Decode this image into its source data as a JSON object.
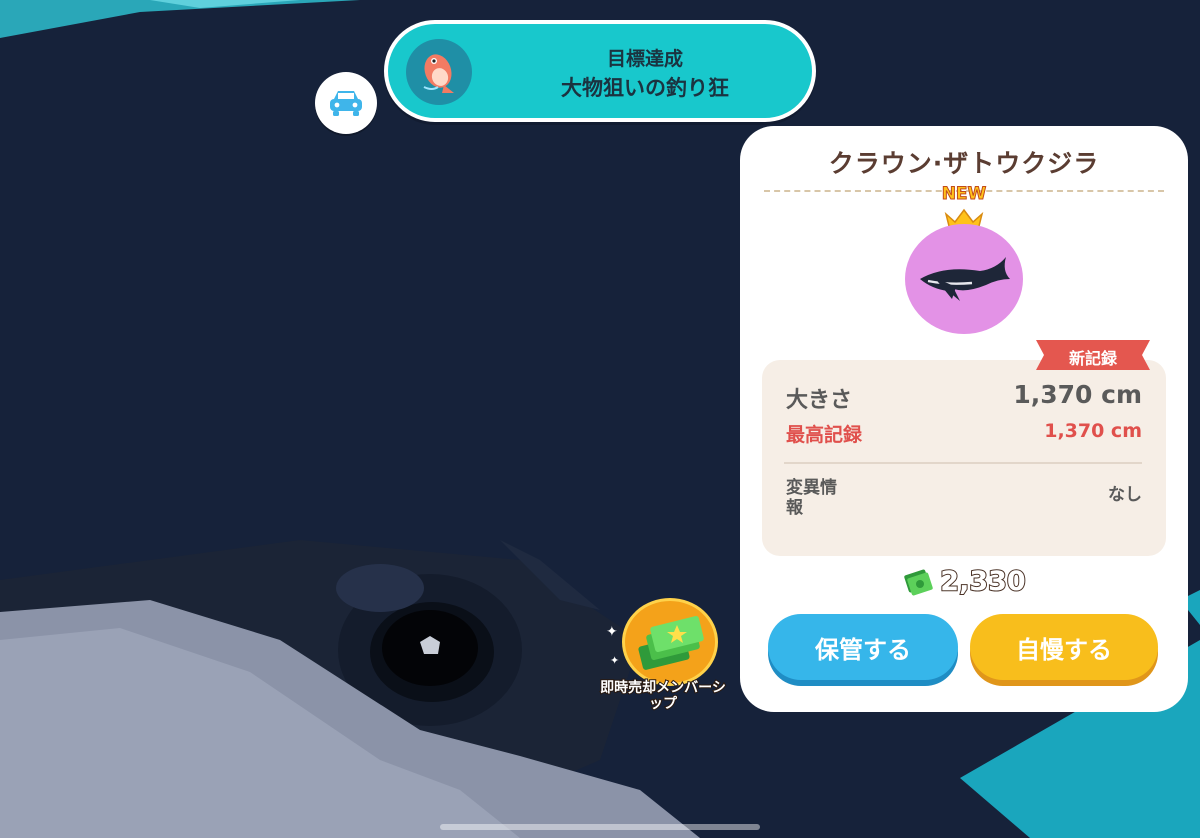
{
  "banner": {
    "title": "目標達成",
    "subtitle": "大物狙いの釣り狂",
    "icon": "fish-icon"
  },
  "car_button": {
    "icon": "car-icon"
  },
  "card": {
    "title": "クラウン·ザトウクジラ",
    "new_badge": "NEW",
    "record_ribbon": "新記録",
    "size_label": "大きさ",
    "size_value": "1,370 cm",
    "best_label": "最高記録",
    "best_value": "1,370 cm",
    "mutation_label": "変異情報",
    "mutation_value": "なし",
    "price": "2,330",
    "store_button": "保管する",
    "boast_button": "自慢する",
    "fish_color": "#e392e6"
  },
  "membership": {
    "label": "即時売却メンバーシップ"
  },
  "colors": {
    "background": "#16223a",
    "banner": "#18c8cc",
    "store": "#36b6ea",
    "boast": "#f8be1c",
    "record": "#e0504c"
  }
}
